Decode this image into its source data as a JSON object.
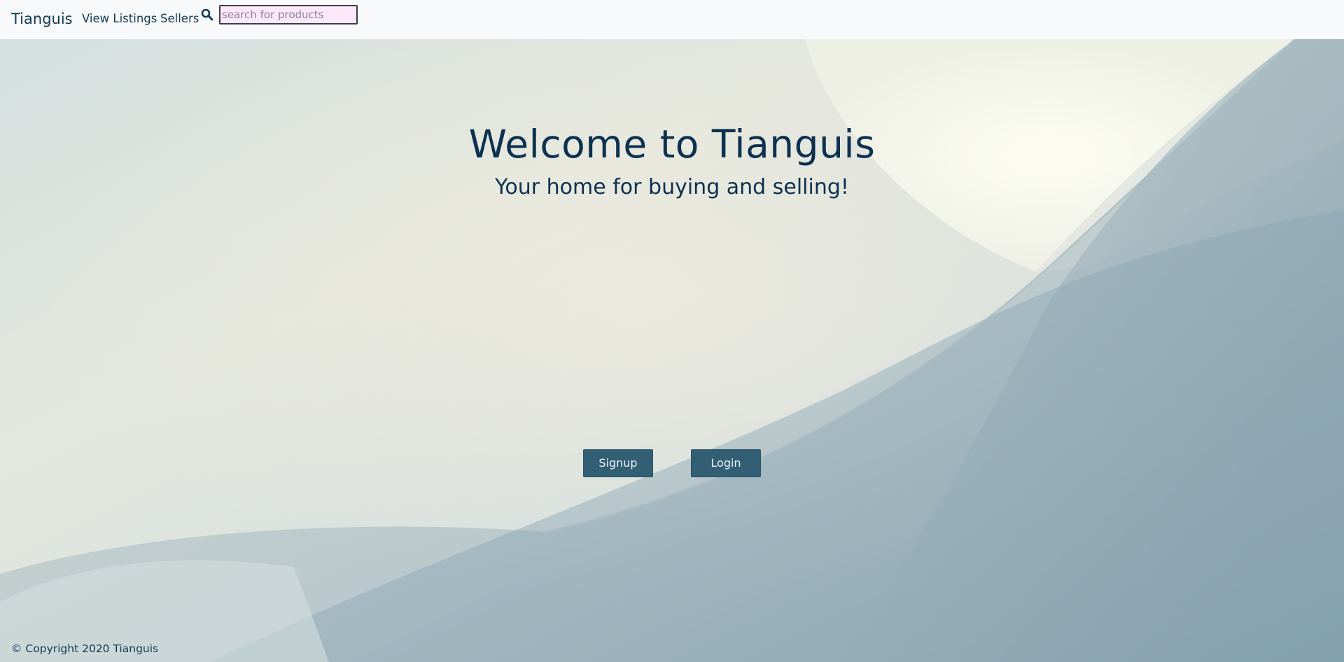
{
  "navbar": {
    "brand": "Tianguis",
    "links": {
      "view_listings": "View Listings",
      "sellers": "Sellers"
    },
    "search": {
      "icon": "search-icon",
      "placeholder": "search for products",
      "value": ""
    }
  },
  "hero": {
    "title": "Welcome to Tianguis",
    "subtitle": "Your home for buying and selling!"
  },
  "actions": {
    "signup_label": "Signup",
    "login_label": "Login"
  },
  "footer": {
    "copyright": "© Copyright 2020 Tianguis"
  },
  "colors": {
    "text": "#0d3150",
    "button": "#325f74",
    "navbar_bg": "#f8f9fb",
    "search_bg": "#fde8fa"
  }
}
